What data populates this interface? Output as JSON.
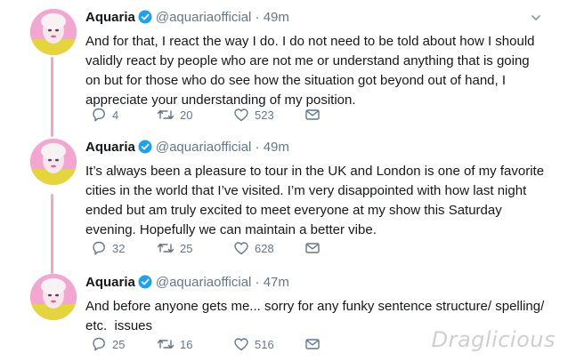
{
  "tweets": [
    {
      "name": "Aquaria",
      "handle": "@aquariaofficial",
      "separator": "·",
      "time": "49m",
      "text": "And for that, I react the way I do. I do not need to be told about how I should validly react by people who are not me or understand anything that is going on but for those who do see how the situation got beyond out of hand, I appreciate your understanding of my position.",
      "replies": "4",
      "retweets": "20",
      "likes": "523"
    },
    {
      "name": "Aquaria",
      "handle": "@aquariaofficial",
      "separator": "·",
      "time": "49m",
      "text": "It’s always been a pleasure to tour in the UK and London is one of my favorite cities in the world that I’ve visited. I’m very disappointed with how last night ended but am truly excited to meet everyone at my show this Saturday evening. Hopefully we can maintain a better vibe.",
      "replies": "32",
      "retweets": "25",
      "likes": "628"
    },
    {
      "name": "Aquaria",
      "handle": "@aquariaofficial",
      "separator": "·",
      "time": "47m",
      "text": "And before anyone gets me... sorry for any funky sentence structure/ spelling/ etc.  issues",
      "replies": "25",
      "retweets": "16",
      "likes": "516"
    }
  ],
  "watermark": "Draglicious",
  "icons": {
    "verified": "verified-badge-icon",
    "reply": "reply-icon",
    "retweet": "retweet-icon",
    "like": "heart-icon",
    "dm": "envelope-icon",
    "menu": "chevron-down-icon"
  },
  "colors": {
    "verified": "#1da1f2",
    "meta": "#657786",
    "thread_line": "#f3a6c6",
    "text": "#14171a"
  }
}
